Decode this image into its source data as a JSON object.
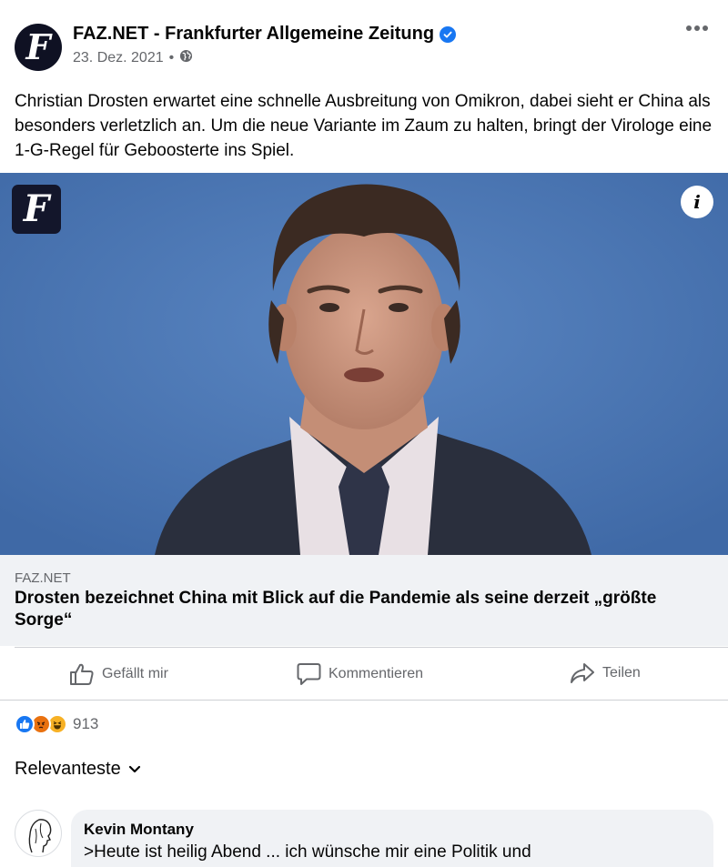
{
  "post": {
    "page_name": "FAZ.NET - Frankfurter Allgemeine Zeitung",
    "verified_icon": "verified-badge-icon",
    "date": "23. Dez. 2021",
    "separator": "•",
    "privacy_icon": "globe-icon",
    "more_icon": "more-options-icon",
    "text": "Christian Drosten erwartet eine schnelle Ausbreitung von Omikron, dabei sieht er China als besonders verletzlich an. Um die neue Variante im Zaum zu halten, bringt der Virologe eine 1-G-Regel für Geboosterte ins Spiel.",
    "logo_letter": "F"
  },
  "link": {
    "source": "FAZ.NET",
    "title": "Drosten bezeichnet China mit Blick auf die Pandemie als seine derzeit „größte Sorge“",
    "info_label": "i"
  },
  "actions": {
    "like_label": "Gefällt mir",
    "comment_label": "Kommentieren",
    "share_label": "Teilen"
  },
  "reactions": {
    "icons": [
      "like-reaction-icon",
      "angry-reaction-icon",
      "haha-reaction-icon"
    ],
    "count": "913"
  },
  "comments": {
    "sort_label": "Relevanteste",
    "items": [
      {
        "author": "Kevin Montany",
        "text": ">Heute ist heilig Abend ... ich wünsche mir eine Politik und"
      }
    ]
  },
  "colors": {
    "brand_blue": "#1877f2",
    "secondary_text": "#65676b",
    "surface": "#f0f2f5",
    "photo_background": "#4b78b5"
  }
}
